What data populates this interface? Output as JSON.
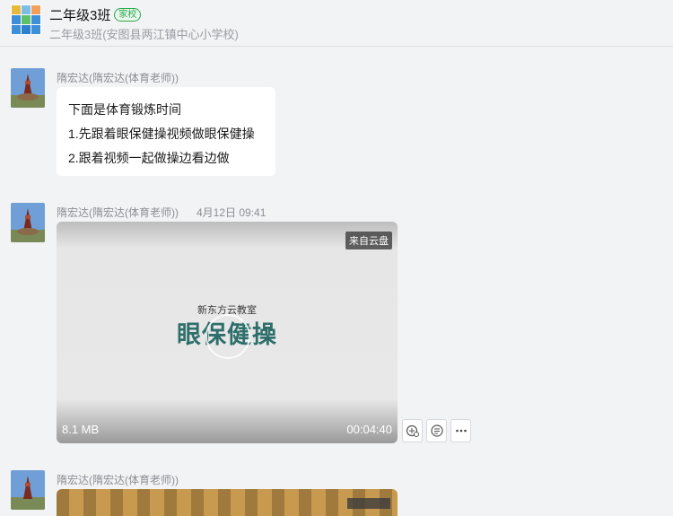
{
  "header": {
    "title": "二年级3班",
    "badge": "家校",
    "subtitle": "二年级3班(安图县两江镇中心小学校)"
  },
  "messages": [
    {
      "sender": "隋宏达(隋宏达(体育老师))",
      "time": "",
      "lines": [
        "下面是体育锻炼时间",
        "1.先跟着眼保健操视频做眼保健操",
        "2.跟着视频一起做操边看边做"
      ]
    },
    {
      "sender": "隋宏达(隋宏达(体育老师))",
      "time": "4月12日 09:41",
      "video": {
        "source_tag": "来自云盘",
        "brand": "新东方云教室",
        "title": "眼保健操",
        "file_size": "8.1 MB",
        "duration": "00:04:40"
      },
      "actions": [
        "collect-icon",
        "note-icon",
        "more-icon"
      ]
    },
    {
      "sender": "隋宏达(隋宏达(体育老师))",
      "time": ""
    }
  ],
  "colors": {
    "background": "#f2f3f5",
    "badge_green": "#2aa84a",
    "video_title": "#2f6f6b"
  }
}
